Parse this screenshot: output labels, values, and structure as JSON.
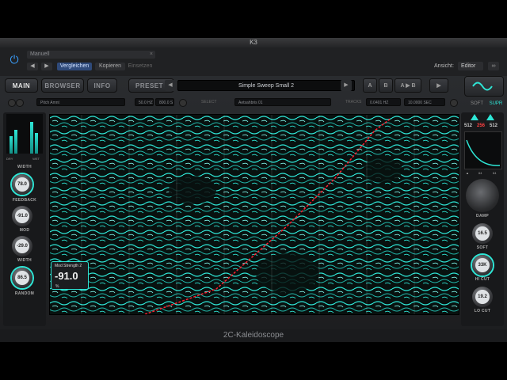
{
  "window": {
    "title": "K3"
  },
  "host": {
    "preset_name": "Manuell",
    "preset_clear": "×",
    "prev": "◀",
    "next": "▶",
    "compare": "Vergleichen",
    "copy": "Kopieren",
    "paste": "Einsetzen",
    "view_label": "Ansicht:",
    "view_value": "Editor",
    "link_icon": "link-icon"
  },
  "nav": {
    "main": "MAIN",
    "browser": "BROWSER",
    "info": "INFO",
    "preset": "PRESET",
    "preset_name": "Simple Sweep Small 2",
    "prev": "◀",
    "next": "▶",
    "a": "A",
    "b": "B",
    "ab": "A ▶ B",
    "play": "▶"
  },
  "params": {
    "f1": "Pitch Amnt",
    "f2": "50.0 HZ",
    "f3": "800.0 S",
    "select_label": "SELECT",
    "f4": "Aetsahbris 01",
    "tracks_label": "TRACKS",
    "f5": "0.0401 HZ",
    "f6": "10.0000 SEC",
    "soft": "SOFT",
    "supr": "SUPR"
  },
  "left": {
    "dry": "DRY",
    "wet": "WET",
    "width_top": "WIDTH",
    "feedback": "FEEDBACK",
    "feedback_val": "78.0",
    "mod": "MOD",
    "mod_val": "-91.0",
    "width": "WIDTH",
    "width_val": "-29.0",
    "random": "RANDOM",
    "random_val": "86.5"
  },
  "tooltip": {
    "title": "Mod Strength 2",
    "value": "-91.0",
    "unit": "%"
  },
  "right": {
    "n1": "512",
    "n2": "256",
    "n3": "512",
    "s1": "▲",
    "s2": "64",
    "s3": "64",
    "damp": "DAMP",
    "soft_val": "16.5",
    "soft": "SOFT",
    "hicut_val": "33K",
    "hicut": "HI CUT",
    "locut_val": "19.2",
    "locut": "LO CUT"
  },
  "footer": {
    "text": "2C-Kaleidoscope"
  },
  "colors": {
    "accent": "#2ee6d6",
    "sweep": "#ff2030",
    "bg": "#1a1b1d"
  }
}
